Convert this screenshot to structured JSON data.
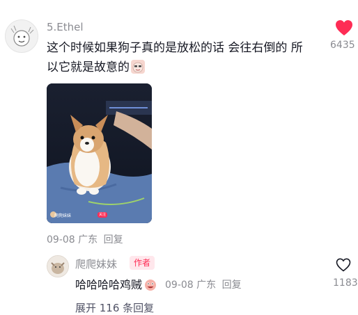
{
  "comment": {
    "username": "5.Ethel",
    "text_line1": "这个时候如果狗子真的是放松的话 会往右倒的 所",
    "text_line2": "以它就是故意的",
    "like_count": "6435",
    "liked": true,
    "like_color": "#fe2c55",
    "date": "09-08",
    "location": "广东",
    "reply_label": "回复",
    "photo_overlay_user": "爬爬妹妹",
    "photo_badge": "关注"
  },
  "reply": {
    "username": "爬爬妹妹",
    "author_badge": "作者",
    "text": "哈哈哈哈鸡贼",
    "date": "09-08",
    "location": "广东",
    "reply_label": "回复",
    "like_count": "1183"
  },
  "expand_label": "展开 116 条回复",
  "icons": {
    "like_filled": "heart-filled-icon",
    "like_outline": "heart-outline-icon",
    "sticker": "sticker-emoji-icon"
  }
}
